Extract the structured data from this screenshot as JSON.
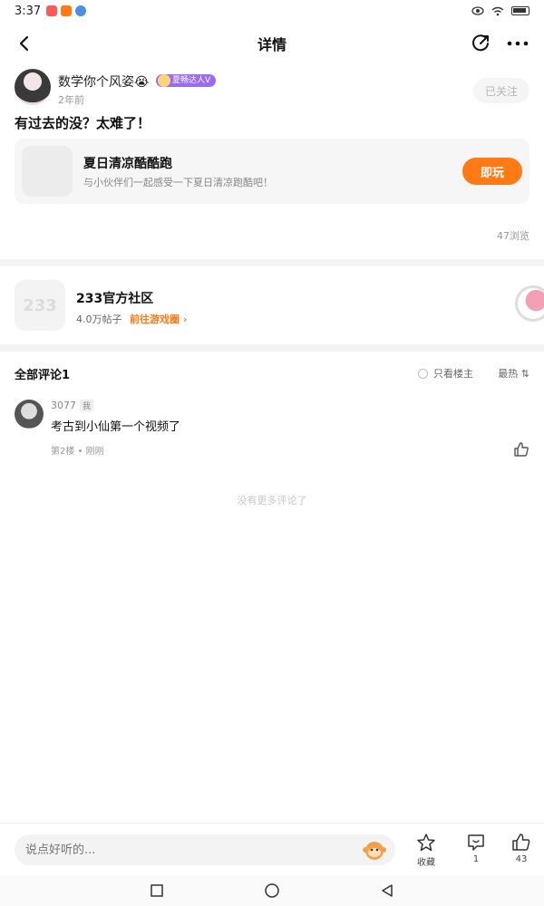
{
  "status": {
    "time": "3:37"
  },
  "header": {
    "title": "详情"
  },
  "post": {
    "author": "数学你个风姿😭",
    "badge": "夏畅达人V",
    "time": "2年前",
    "follow_label": "已关注",
    "text": "有过去的没？太难了！"
  },
  "game": {
    "title": "夏日清凉酷酷跑",
    "desc": "与小伙伴们一起感受一下夏日清凉跑酷吧！",
    "play_label": "即玩"
  },
  "views": "47浏览",
  "community": {
    "logo": "233",
    "name": "233官方社区",
    "count": "4.0万帖子",
    "link": "前往游戏圈 ›"
  },
  "comments": {
    "title": "全部评论1",
    "only_op": "只看楼主",
    "sort": "最热 ⇅",
    "items": [
      {
        "user": "3077",
        "me_tag": "我",
        "text": "考古到小仙第一个视频了",
        "meta": "第2楼 • 刚刚"
      }
    ],
    "no_more": "没有更多评论了"
  },
  "bottom": {
    "placeholder": "说点好听的...",
    "collect_label": "收藏",
    "comment_count": "1",
    "like_count": "43"
  },
  "colors": {
    "accent": "#ff7a15",
    "badge": "#9c6bf5"
  }
}
